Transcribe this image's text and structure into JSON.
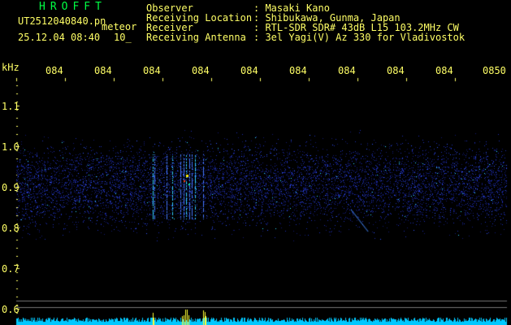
{
  "header": {
    "app_title": "HROFFT",
    "filename": "UT2512040840.pn",
    "type_label": "meteor",
    "datetime": "25.12.04 08:40",
    "count": "10_"
  },
  "meta": [
    {
      "label": "Observer",
      "value": ": Masaki Kano"
    },
    {
      "label": "Receiving Location",
      "value": ": Shibukawa, Gunma, Japan"
    },
    {
      "label": "Receiver",
      "value": ": RTL-SDR SDR# 43dB L15 103.2MHz CW"
    },
    {
      "label": "Receiving Antenna",
      "value": ": 3el Yagi(V) Az 330 for Vladivostok"
    }
  ],
  "axes": {
    "y_unit": "kHz",
    "y_ticks": [
      "1.1",
      "1.0",
      "0.9",
      "0.8",
      "0.7",
      "0.6"
    ],
    "x_ticks": [
      "084",
      "084",
      "084",
      "084",
      "084",
      "084",
      "084",
      "084",
      "084",
      "0850"
    ]
  },
  "colors": {
    "background": "#000000",
    "header_green": "#00ff44",
    "label_yellow": "#ffff66",
    "signal_blue": "#2233cc",
    "baseline_cyan": "#00c8ff"
  }
}
